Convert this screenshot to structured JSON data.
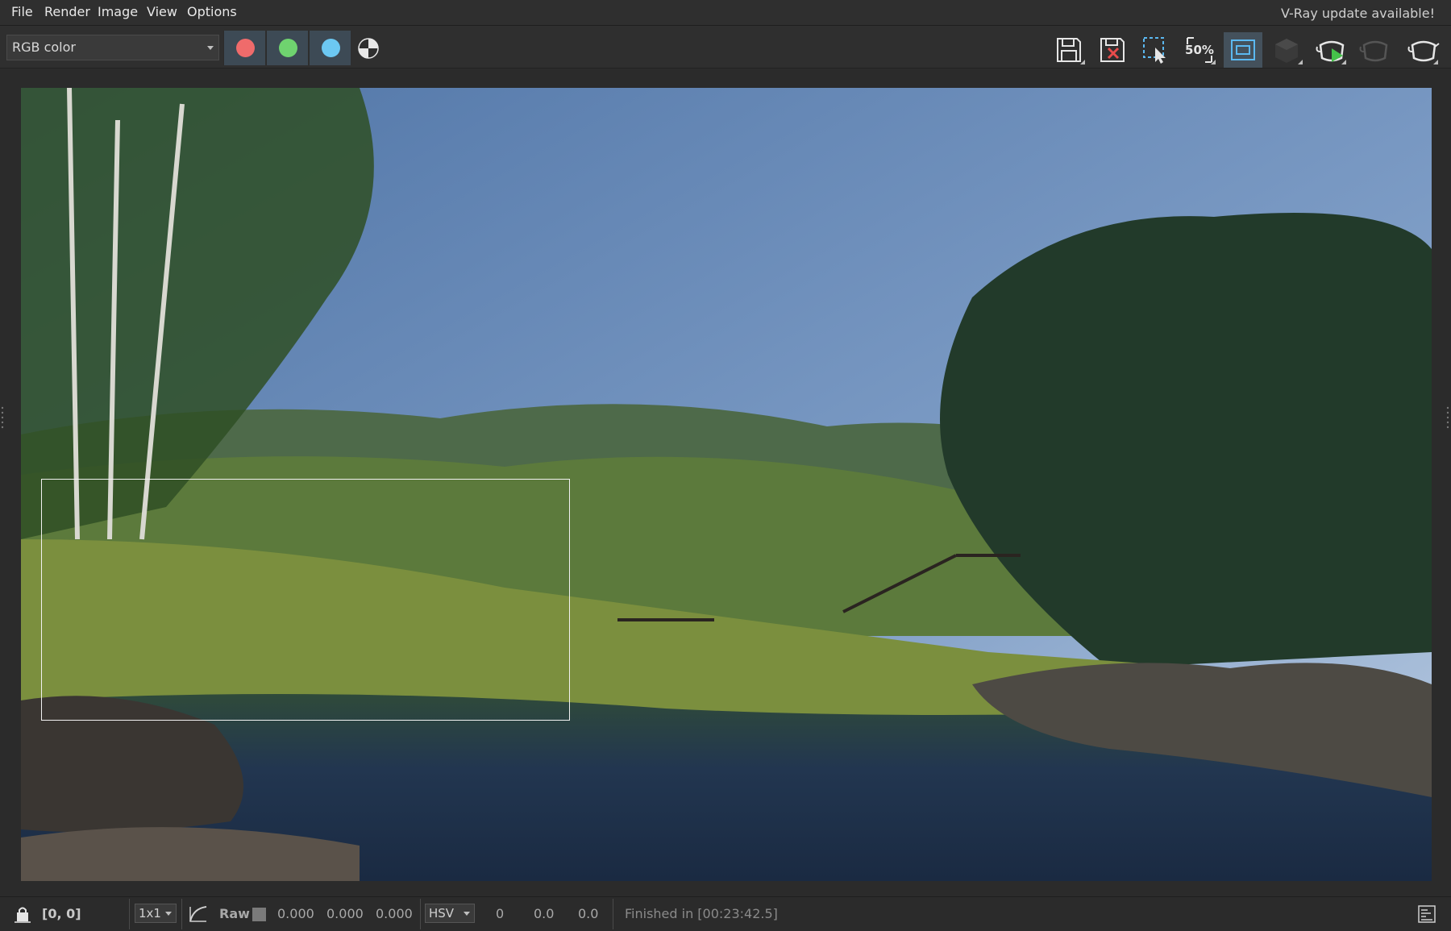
{
  "menu": {
    "items": [
      {
        "label": "File"
      },
      {
        "label": "Render"
      },
      {
        "label": "Image"
      },
      {
        "label": "View"
      },
      {
        "label": "Options"
      }
    ],
    "update_notice": "V-Ray update available!"
  },
  "toolbar": {
    "channel_select": {
      "value": "RGB color"
    },
    "channel_buttons": [
      {
        "icon": "red-channel-icon",
        "color": "#ef6b6b"
      },
      {
        "icon": "green-channel-icon",
        "color": "#6fd36f"
      },
      {
        "icon": "blue-channel-icon",
        "color": "#6cc8f2"
      }
    ],
    "alpha_icon": "alpha-channel-icon",
    "right_icons": [
      {
        "name": "save-image-icon"
      },
      {
        "name": "clear-image-icon"
      },
      {
        "name": "region-select-icon"
      },
      {
        "name": "zoom-50-icon",
        "label": "50%"
      },
      {
        "name": "region-render-icon",
        "active": true
      },
      {
        "name": "cube-icon"
      },
      {
        "name": "render-interactive-icon"
      },
      {
        "name": "render-disabled-icon"
      },
      {
        "name": "render-teapot-icon"
      }
    ]
  },
  "status": {
    "coords": "[0, 0]",
    "sample_size": "1x1",
    "raw_label": "Raw",
    "rgb_values": [
      "0.000",
      "0.000",
      "0.000"
    ],
    "color_mode": "HSV",
    "hsv_values": [
      "0",
      "0.0",
      "0.0"
    ],
    "message": "Finished in [00:23:42.5]"
  },
  "colors": {
    "background": "#2b2b2b",
    "panel": "#2f2f2f",
    "active_button": "#44515c"
  }
}
